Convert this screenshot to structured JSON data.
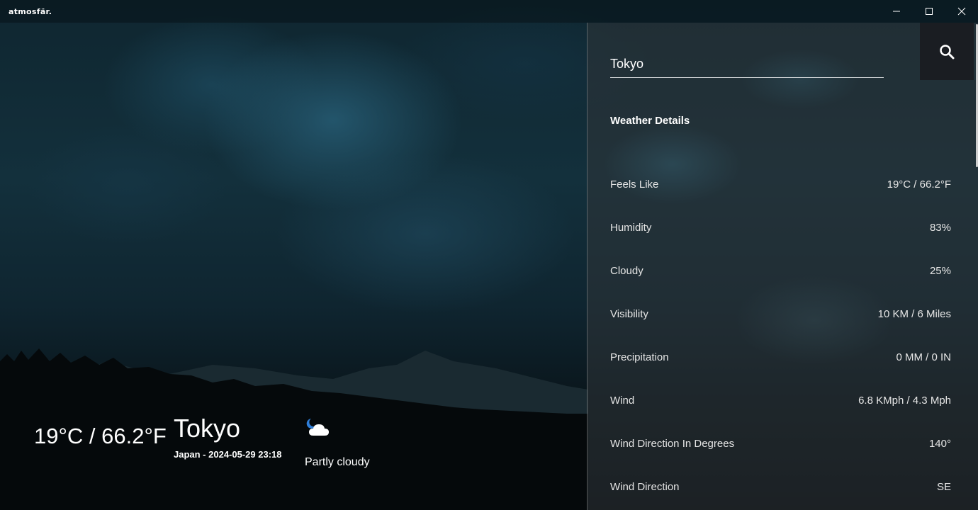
{
  "app": {
    "title": "atmosfär."
  },
  "window_controls": {
    "minimize_icon": "minimize-icon",
    "maximize_icon": "maximize-icon",
    "close_icon": "close-icon"
  },
  "current": {
    "temperature": "19°C / 66.2°F",
    "city": "Tokyo",
    "subtitle": "Japan - 2024-05-29 23:18",
    "condition": "Partly cloudy",
    "condition_icon": "partly-cloudy-night-icon"
  },
  "search": {
    "value": "Tokyo",
    "button_icon": "search-icon"
  },
  "details": {
    "title": "Weather Details",
    "rows": [
      {
        "label": "Feels Like",
        "value": "19°C / 66.2°F"
      },
      {
        "label": "Humidity",
        "value": "83%"
      },
      {
        "label": "Cloudy",
        "value": "25%"
      },
      {
        "label": "Visibility",
        "value": "10 KM / 6 Miles"
      },
      {
        "label": "Precipitation",
        "value": "0 MM / 0 IN"
      },
      {
        "label": "Wind",
        "value": "6.8 KMph / 4.3 Mph"
      },
      {
        "label": "Wind Direction In Degrees",
        "value": "140°"
      },
      {
        "label": "Wind Direction",
        "value": "SE"
      }
    ]
  },
  "colors": {
    "panel_bg": "#303438",
    "search_button_bg": "#1a1d22",
    "text": "#ffffff"
  }
}
